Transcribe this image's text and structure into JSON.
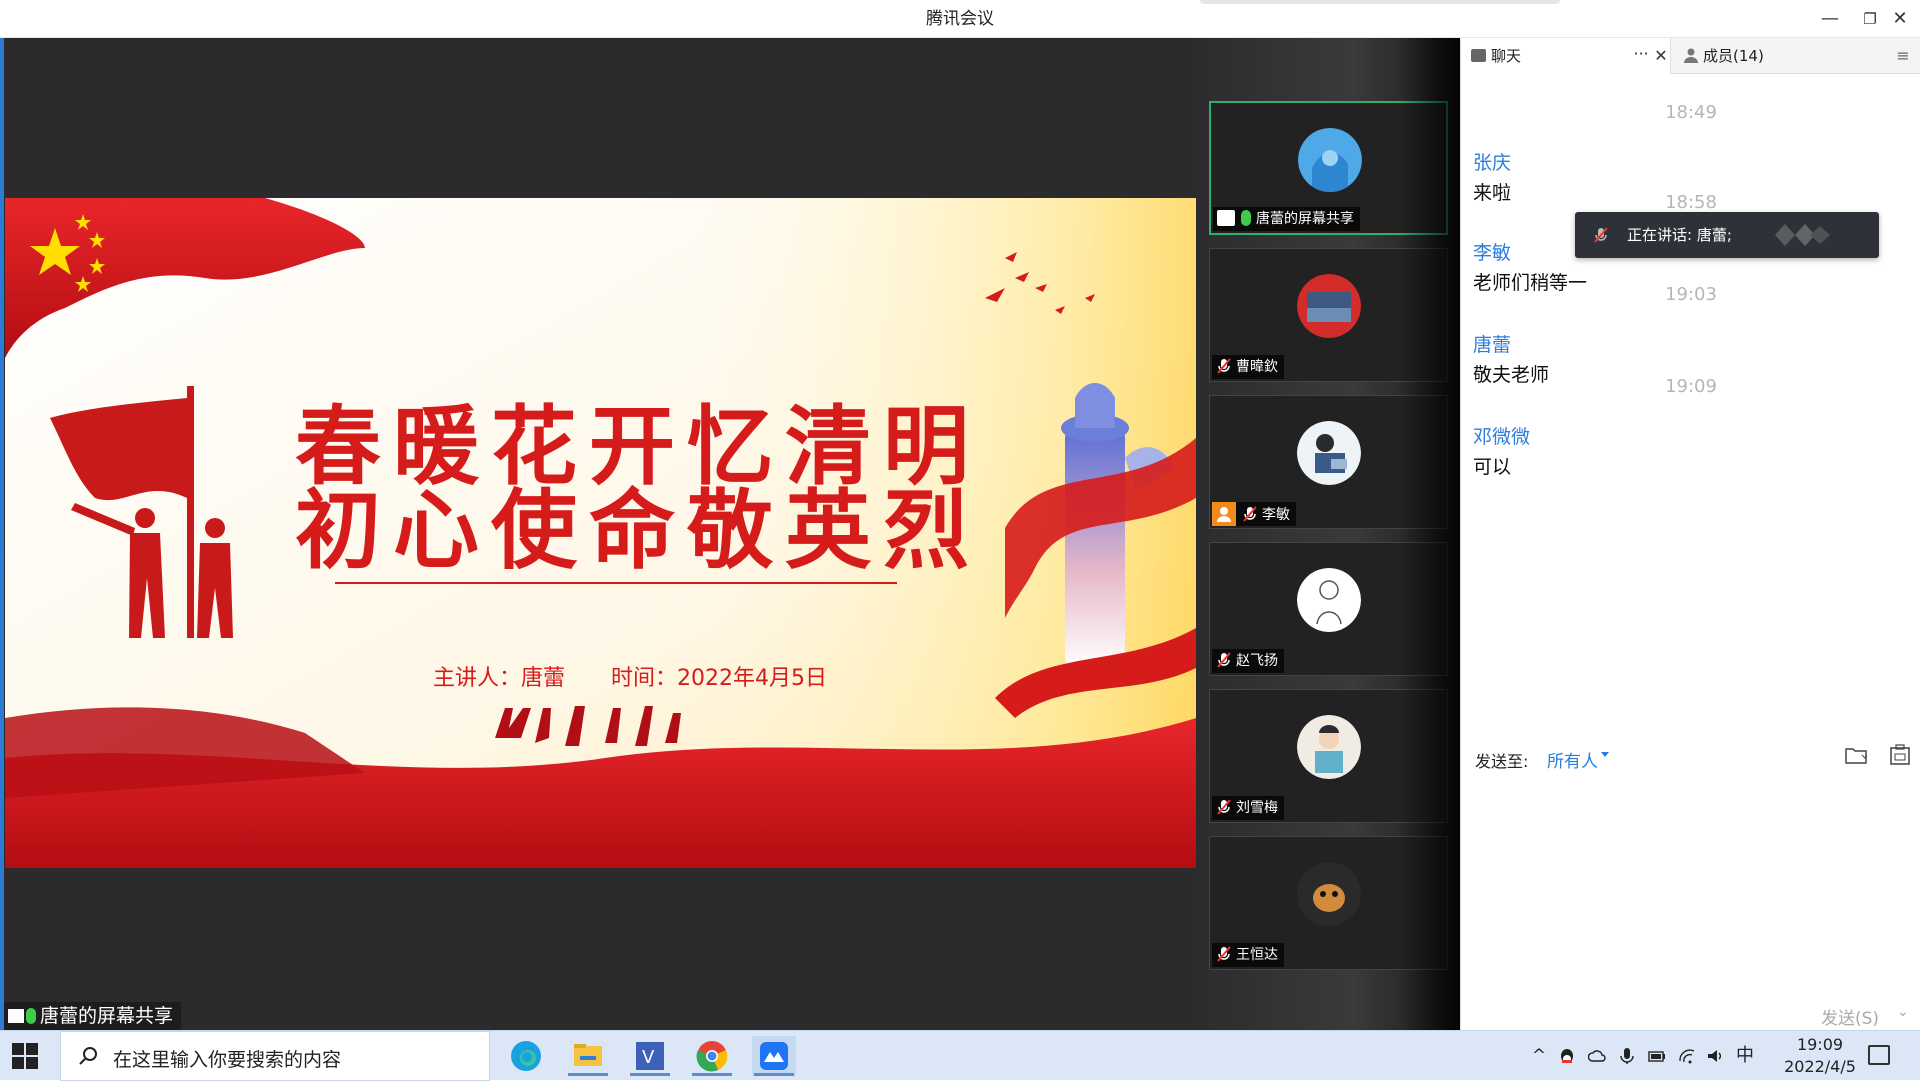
{
  "window": {
    "title": "腾讯会议",
    "minimize_icon": "minimize-icon",
    "restore_icon": "restore-icon",
    "close_icon": "close-icon"
  },
  "slide": {
    "line1": "春暖花开忆清明",
    "line2": "初心使命敬英烈",
    "presenter": "主讲人：唐蕾",
    "time": "时间：2022年4月5日"
  },
  "share_badge": {
    "label": "唐蕾的屏幕共享"
  },
  "video_tiles": [
    {
      "label": "唐蕾的屏幕共享",
      "mic": "on",
      "active": true
    },
    {
      "label": "曹暐欽",
      "mic": "off",
      "active": false
    },
    {
      "label": "李敏",
      "mic": "off",
      "active": false
    },
    {
      "label": "赵飞扬",
      "mic": "off",
      "active": false
    },
    {
      "label": "刘雪梅",
      "mic": "off",
      "active": false
    },
    {
      "label": "王恒达",
      "mic": "off",
      "active": false
    }
  ],
  "chat": {
    "tab_chat": "聊天",
    "tab_more": "···",
    "tab_close": "✕",
    "tab_members": "成员(14)",
    "tab_menu": "≡",
    "messages": [
      {
        "time": "18:49",
        "sender": "张庆",
        "text": "来啦"
      },
      {
        "time": "18:58",
        "sender": "李敏",
        "text": "老师们稍等一"
      },
      {
        "time": "19:03",
        "sender": "唐蕾",
        "text": "敬夫老师"
      },
      {
        "time": "19:09",
        "sender": "邓微微",
        "text": "可以"
      }
    ],
    "speaking": "正在讲话: 唐蕾;",
    "send_label": "发送至:",
    "send_to": "所有人",
    "send_button": "发送(S)",
    "send_chevron": "⌄"
  },
  "taskbar": {
    "search_placeholder": "在这里输入你要搜索的内容",
    "tray_caret": "^",
    "ime": "中",
    "clock_time": "19:09",
    "clock_date": "2022/4/5"
  },
  "colors": {
    "accent_blue": "#2c7de0",
    "slide_red": "#d61b1b",
    "mic_green": "#3fcc4a",
    "stage_bg": "#2b2b2d"
  }
}
